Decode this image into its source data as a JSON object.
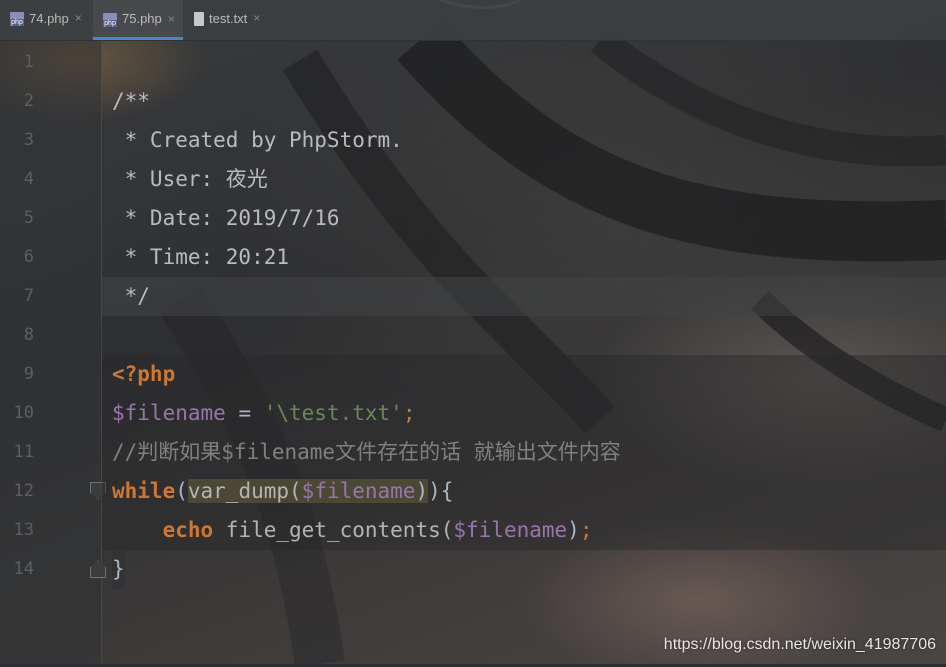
{
  "tabs": [
    {
      "label": "74.php",
      "icon": "php-file-icon",
      "active": false
    },
    {
      "label": "75.php",
      "icon": "php-file-icon",
      "active": true
    },
    {
      "label": "test.txt",
      "icon": "text-file-icon",
      "active": false
    }
  ],
  "close_glyph": "×",
  "line_numbers": [
    "1",
    "2",
    "3",
    "4",
    "5",
    "6",
    "7",
    "8",
    "9",
    "10",
    "11",
    "12",
    "13",
    "14"
  ],
  "code": {
    "l2": "/**",
    "l3": " * Created by PhpStorm.",
    "l4": " * User: 夜光",
    "l5": " * Date: 2019/7/16",
    "l6": " * Time: 20:21",
    "l7": " */",
    "l9": "<?php",
    "l10_var": "$filename",
    "l10_eq": " = ",
    "l10_str": "'\\test.txt'",
    "l10_semi": ";",
    "l11": "//判断如果$filename文件存在的话 就输出文件内容",
    "l12_kw": "while",
    "l12_open": "(",
    "l12_fn": "var_dump(",
    "l12_var": "$filename",
    "l12_close_inner": ")",
    "l12_rest": "){",
    "l13_indent": "    ",
    "l13_kw": "echo",
    "l13_fn": " file_get_contents(",
    "l13_var": "$filename",
    "l13_close": ")",
    "l13_semi": ";",
    "l14": "}"
  },
  "watermark": "https://blog.csdn.net/weixin_41987706",
  "colors": {
    "keyword": "#cc7832",
    "variable": "#9876aa",
    "string": "#6a8759",
    "comment": "#808080",
    "accent_tab": "#4a88c7"
  }
}
